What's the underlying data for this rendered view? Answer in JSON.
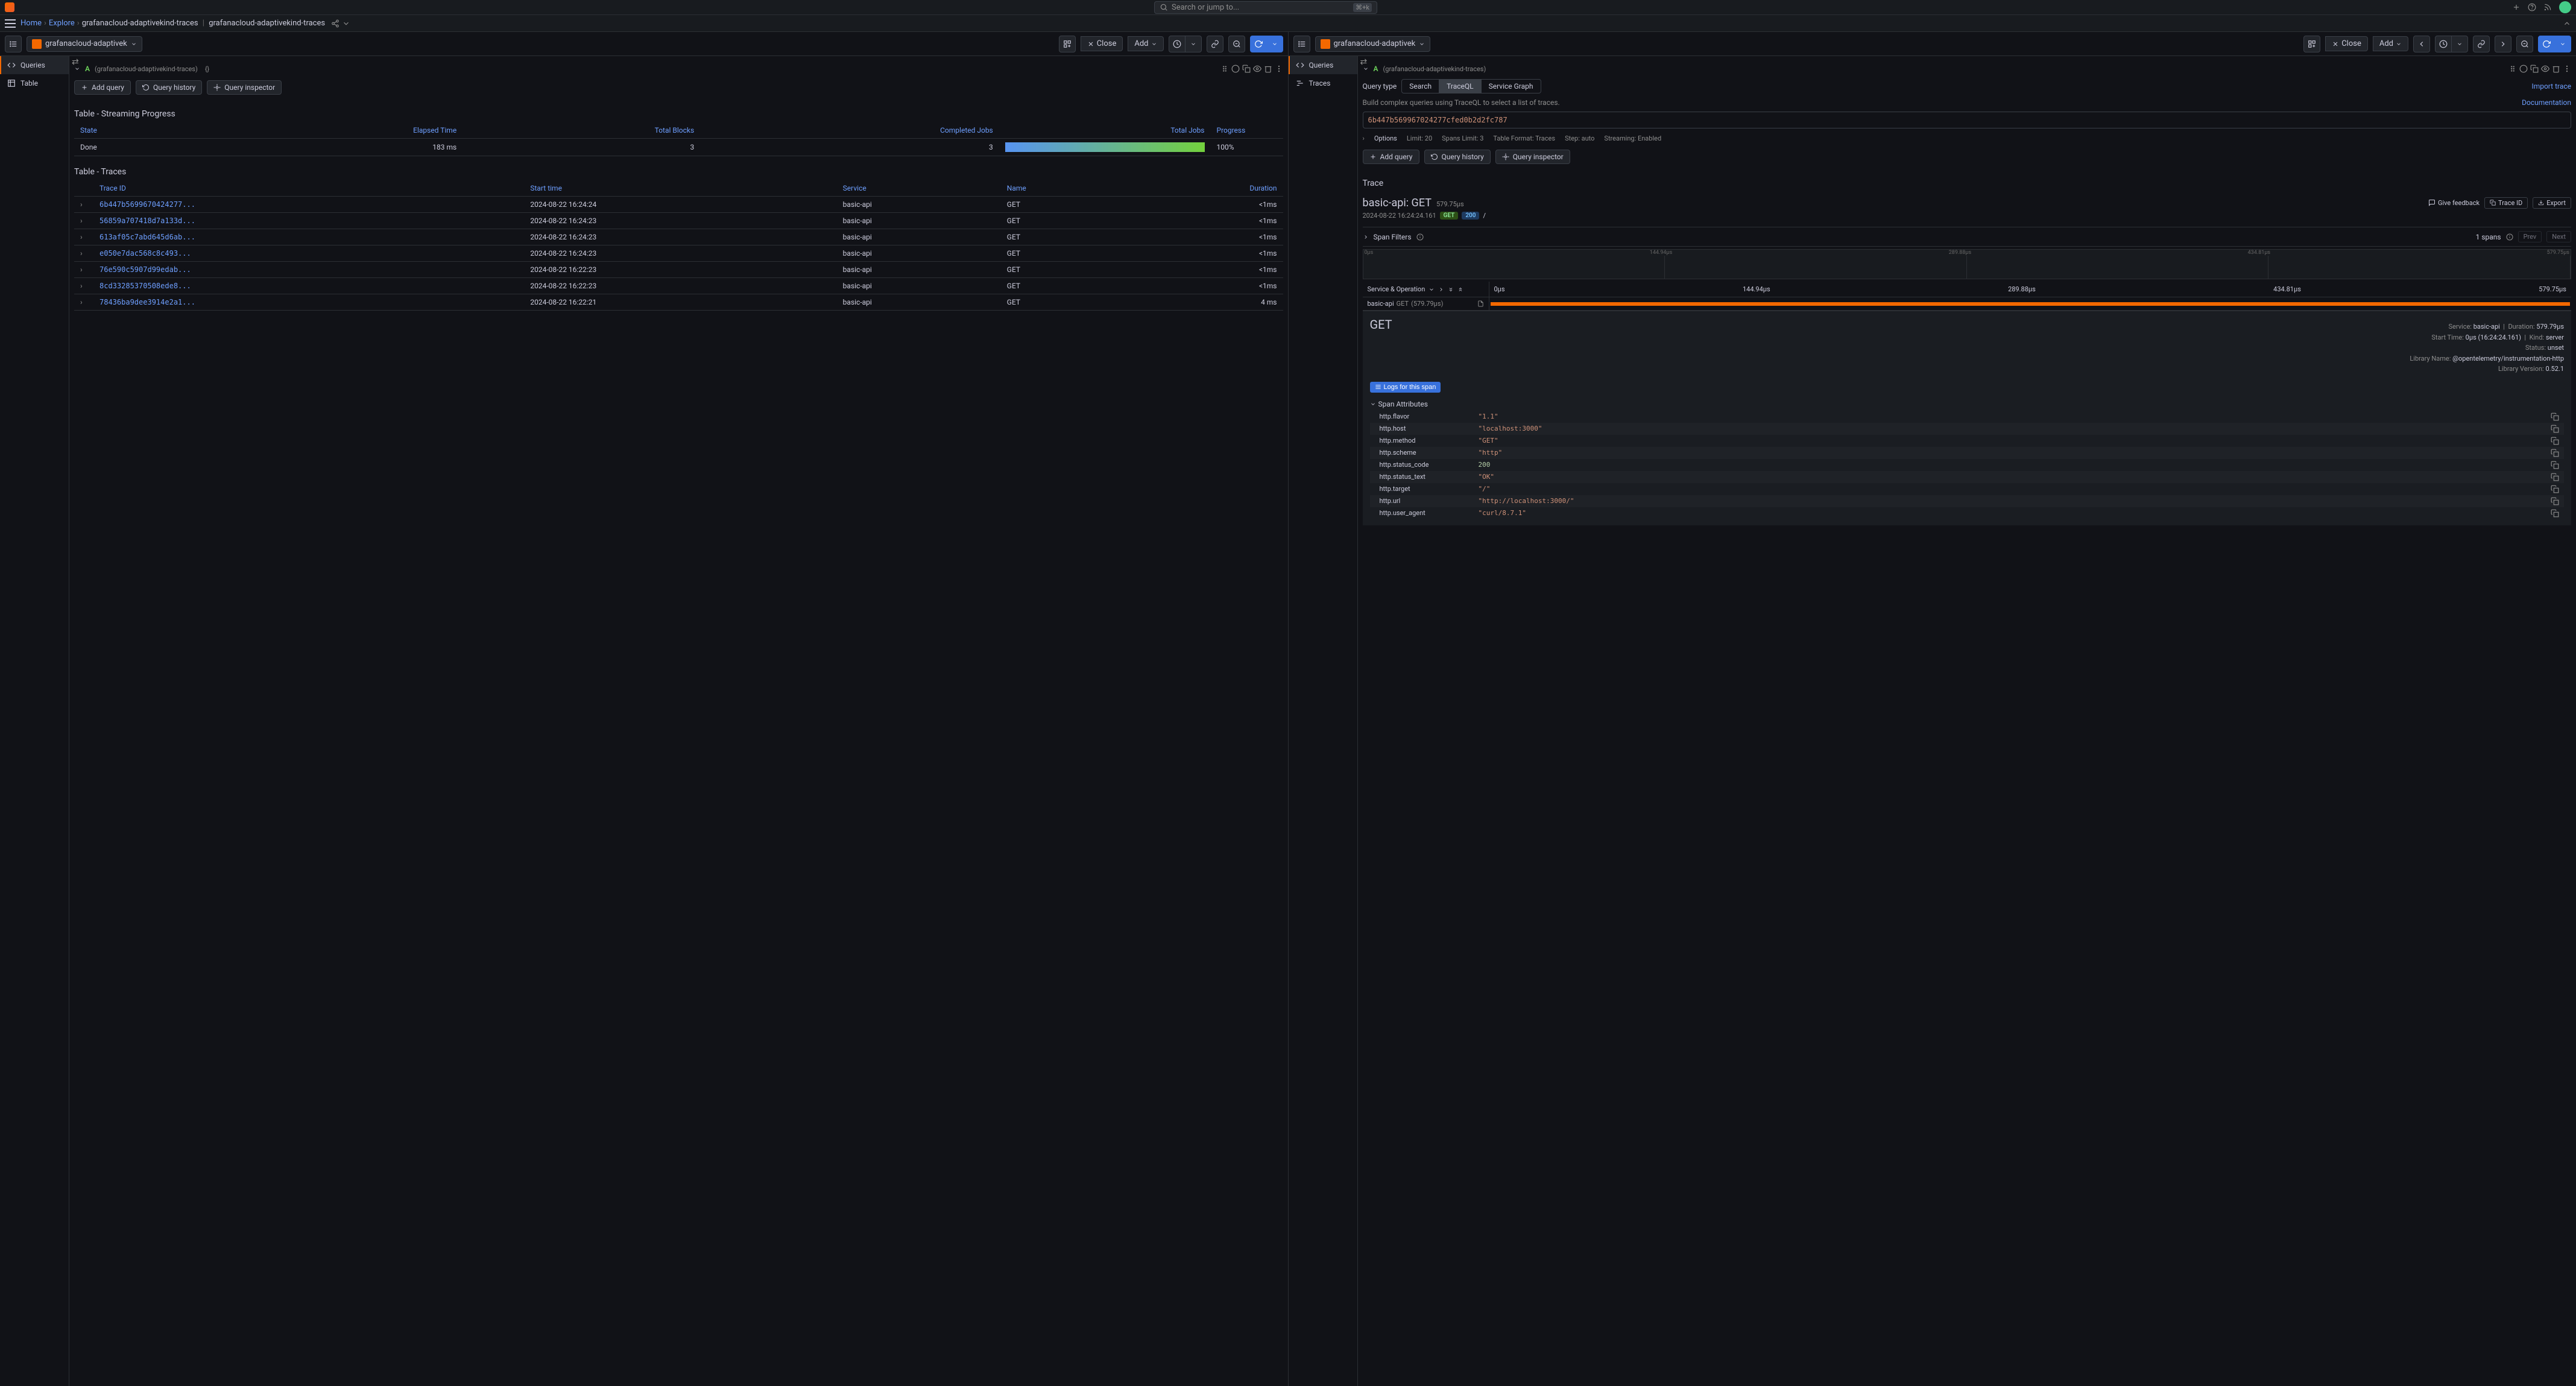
{
  "global": {
    "search_placeholder": "Search or jump to...",
    "kbd": "⌘+k"
  },
  "breadcrumb": {
    "home": "Home",
    "explore": "Explore",
    "ds1": "grafanacloud-adaptivekind-traces",
    "ds2": "grafanacloud-adaptivekind-traces"
  },
  "left_pane": {
    "ds_name": "grafanacloud-adaptivek",
    "close": "Close",
    "add": "Add",
    "side_tabs": [
      "Queries",
      "Table"
    ],
    "query_letter": "A",
    "query_sub": "(grafanacloud-adaptivekind-traces)",
    "query_expr": "{}",
    "actions": {
      "add_query": "Add query",
      "query_history": "Query history",
      "query_inspector": "Query inspector"
    },
    "streaming": {
      "title": "Table - Streaming Progress",
      "headers": [
        "State",
        "Elapsed Time",
        "Total Blocks",
        "Completed Jobs",
        "Total Jobs",
        "Progress"
      ],
      "row": {
        "state": "Done",
        "elapsed": "183 ms",
        "blocks": "3",
        "completed": "3",
        "total": "100%"
      }
    },
    "traces": {
      "title": "Table - Traces",
      "headers": [
        "Trace ID",
        "Start time",
        "Service",
        "Name",
        "Duration"
      ],
      "rows": [
        {
          "id": "6b447b5699670424277...",
          "time": "2024-08-22 16:24:24",
          "service": "basic-api",
          "name": "GET",
          "dur": "<1ms"
        },
        {
          "id": "56859a707418d7a133d...",
          "time": "2024-08-22 16:24:23",
          "service": "basic-api",
          "name": "GET",
          "dur": "<1ms"
        },
        {
          "id": "613af05c7abd645d6ab...",
          "time": "2024-08-22 16:24:23",
          "service": "basic-api",
          "name": "GET",
          "dur": "<1ms"
        },
        {
          "id": "e050e7dac568c8c493...",
          "time": "2024-08-22 16:24:23",
          "service": "basic-api",
          "name": "GET",
          "dur": "<1ms"
        },
        {
          "id": "76e590c5907d99edab...",
          "time": "2024-08-22 16:22:23",
          "service": "basic-api",
          "name": "GET",
          "dur": "<1ms"
        },
        {
          "id": "8cd33285370508ede8...",
          "time": "2024-08-22 16:22:23",
          "service": "basic-api",
          "name": "GET",
          "dur": "<1ms"
        },
        {
          "id": "78436ba9dee3914e2a1...",
          "time": "2024-08-22 16:22:21",
          "service": "basic-api",
          "name": "GET",
          "dur": "4 ms"
        }
      ]
    }
  },
  "right_pane": {
    "ds_name": "grafanacloud-adaptivek",
    "close": "Close",
    "add": "Add",
    "side_tabs": [
      "Queries",
      "Traces"
    ],
    "query_letter": "A",
    "query_sub": "(grafanacloud-adaptivekind-traces)",
    "query_type_label": "Query type",
    "query_types": [
      "Search",
      "TraceQL",
      "Service Graph"
    ],
    "import": "Import trace",
    "hint": "Build complex queries using TraceQL to select a list of traces.",
    "doc": "Documentation",
    "traceql_value": "6b447b569967024277cfed0b2d2fc787",
    "options": {
      "label": "Options",
      "limit": "Limit: 20",
      "spans_limit": "Spans Limit: 3",
      "format": "Table Format: Traces",
      "step": "Step: auto",
      "streaming": "Streaming: Enabled"
    },
    "actions": {
      "add_query": "Add query",
      "query_history": "Query history",
      "query_inspector": "Query inspector"
    },
    "trace_section_title": "Trace",
    "trace": {
      "title": "basic-api: GET",
      "dur": "579.75µs",
      "feedback": "Give feedback",
      "trace_id_btn": "Trace ID",
      "export_btn": "Export",
      "timestamp": "2024-08-22 16:24:24.161",
      "method_chip": "GET",
      "status_chip": "200",
      "path": "/"
    },
    "span_filters": {
      "label": "Span Filters",
      "count": "1 spans",
      "prev": "Prev",
      "next": "Next"
    },
    "minimap_labels": [
      "0µs",
      "144.94µs",
      "289.88µs",
      "434.81µs",
      "579.75µs"
    ],
    "gantt": {
      "left_header": "Service & Operation",
      "time_labels": [
        "0µs",
        "144.94µs",
        "289.88µs",
        "434.81µs",
        "579.75µs"
      ],
      "row": {
        "service": "basic-api",
        "op": "GET",
        "dur": "(579.79µs)"
      }
    },
    "span_detail": {
      "op": "GET",
      "service_label": "Service:",
      "service": "basic-api",
      "duration_label": "Duration:",
      "duration": "579.79µs",
      "start_label": "Start Time:",
      "start": "0µs (16:24:24.161)",
      "kind_label": "Kind:",
      "kind": "server",
      "status_label": "Status:",
      "status": "unset",
      "lib_label": "Library Name:",
      "lib": "@opentelemetry/instrumentation-http",
      "libver_label": "Library Version:",
      "libver": "0.52.1",
      "logs_btn": "Logs for this span",
      "attrs_header": "Span Attributes",
      "attrs": [
        {
          "k": "http.flavor",
          "v": "\"1.1\"",
          "type": "str"
        },
        {
          "k": "http.host",
          "v": "\"localhost:3000\"",
          "type": "str"
        },
        {
          "k": "http.method",
          "v": "\"GET\"",
          "type": "str"
        },
        {
          "k": "http.scheme",
          "v": "\"http\"",
          "type": "str"
        },
        {
          "k": "http.status_code",
          "v": "200",
          "type": "num"
        },
        {
          "k": "http.status_text",
          "v": "\"OK\"",
          "type": "str"
        },
        {
          "k": "http.target",
          "v": "\"/\"",
          "type": "str"
        },
        {
          "k": "http.url",
          "v": "\"http://localhost:3000/\"",
          "type": "str"
        },
        {
          "k": "http.user_agent",
          "v": "\"curl/8.7.1\"",
          "type": "str"
        }
      ]
    }
  }
}
